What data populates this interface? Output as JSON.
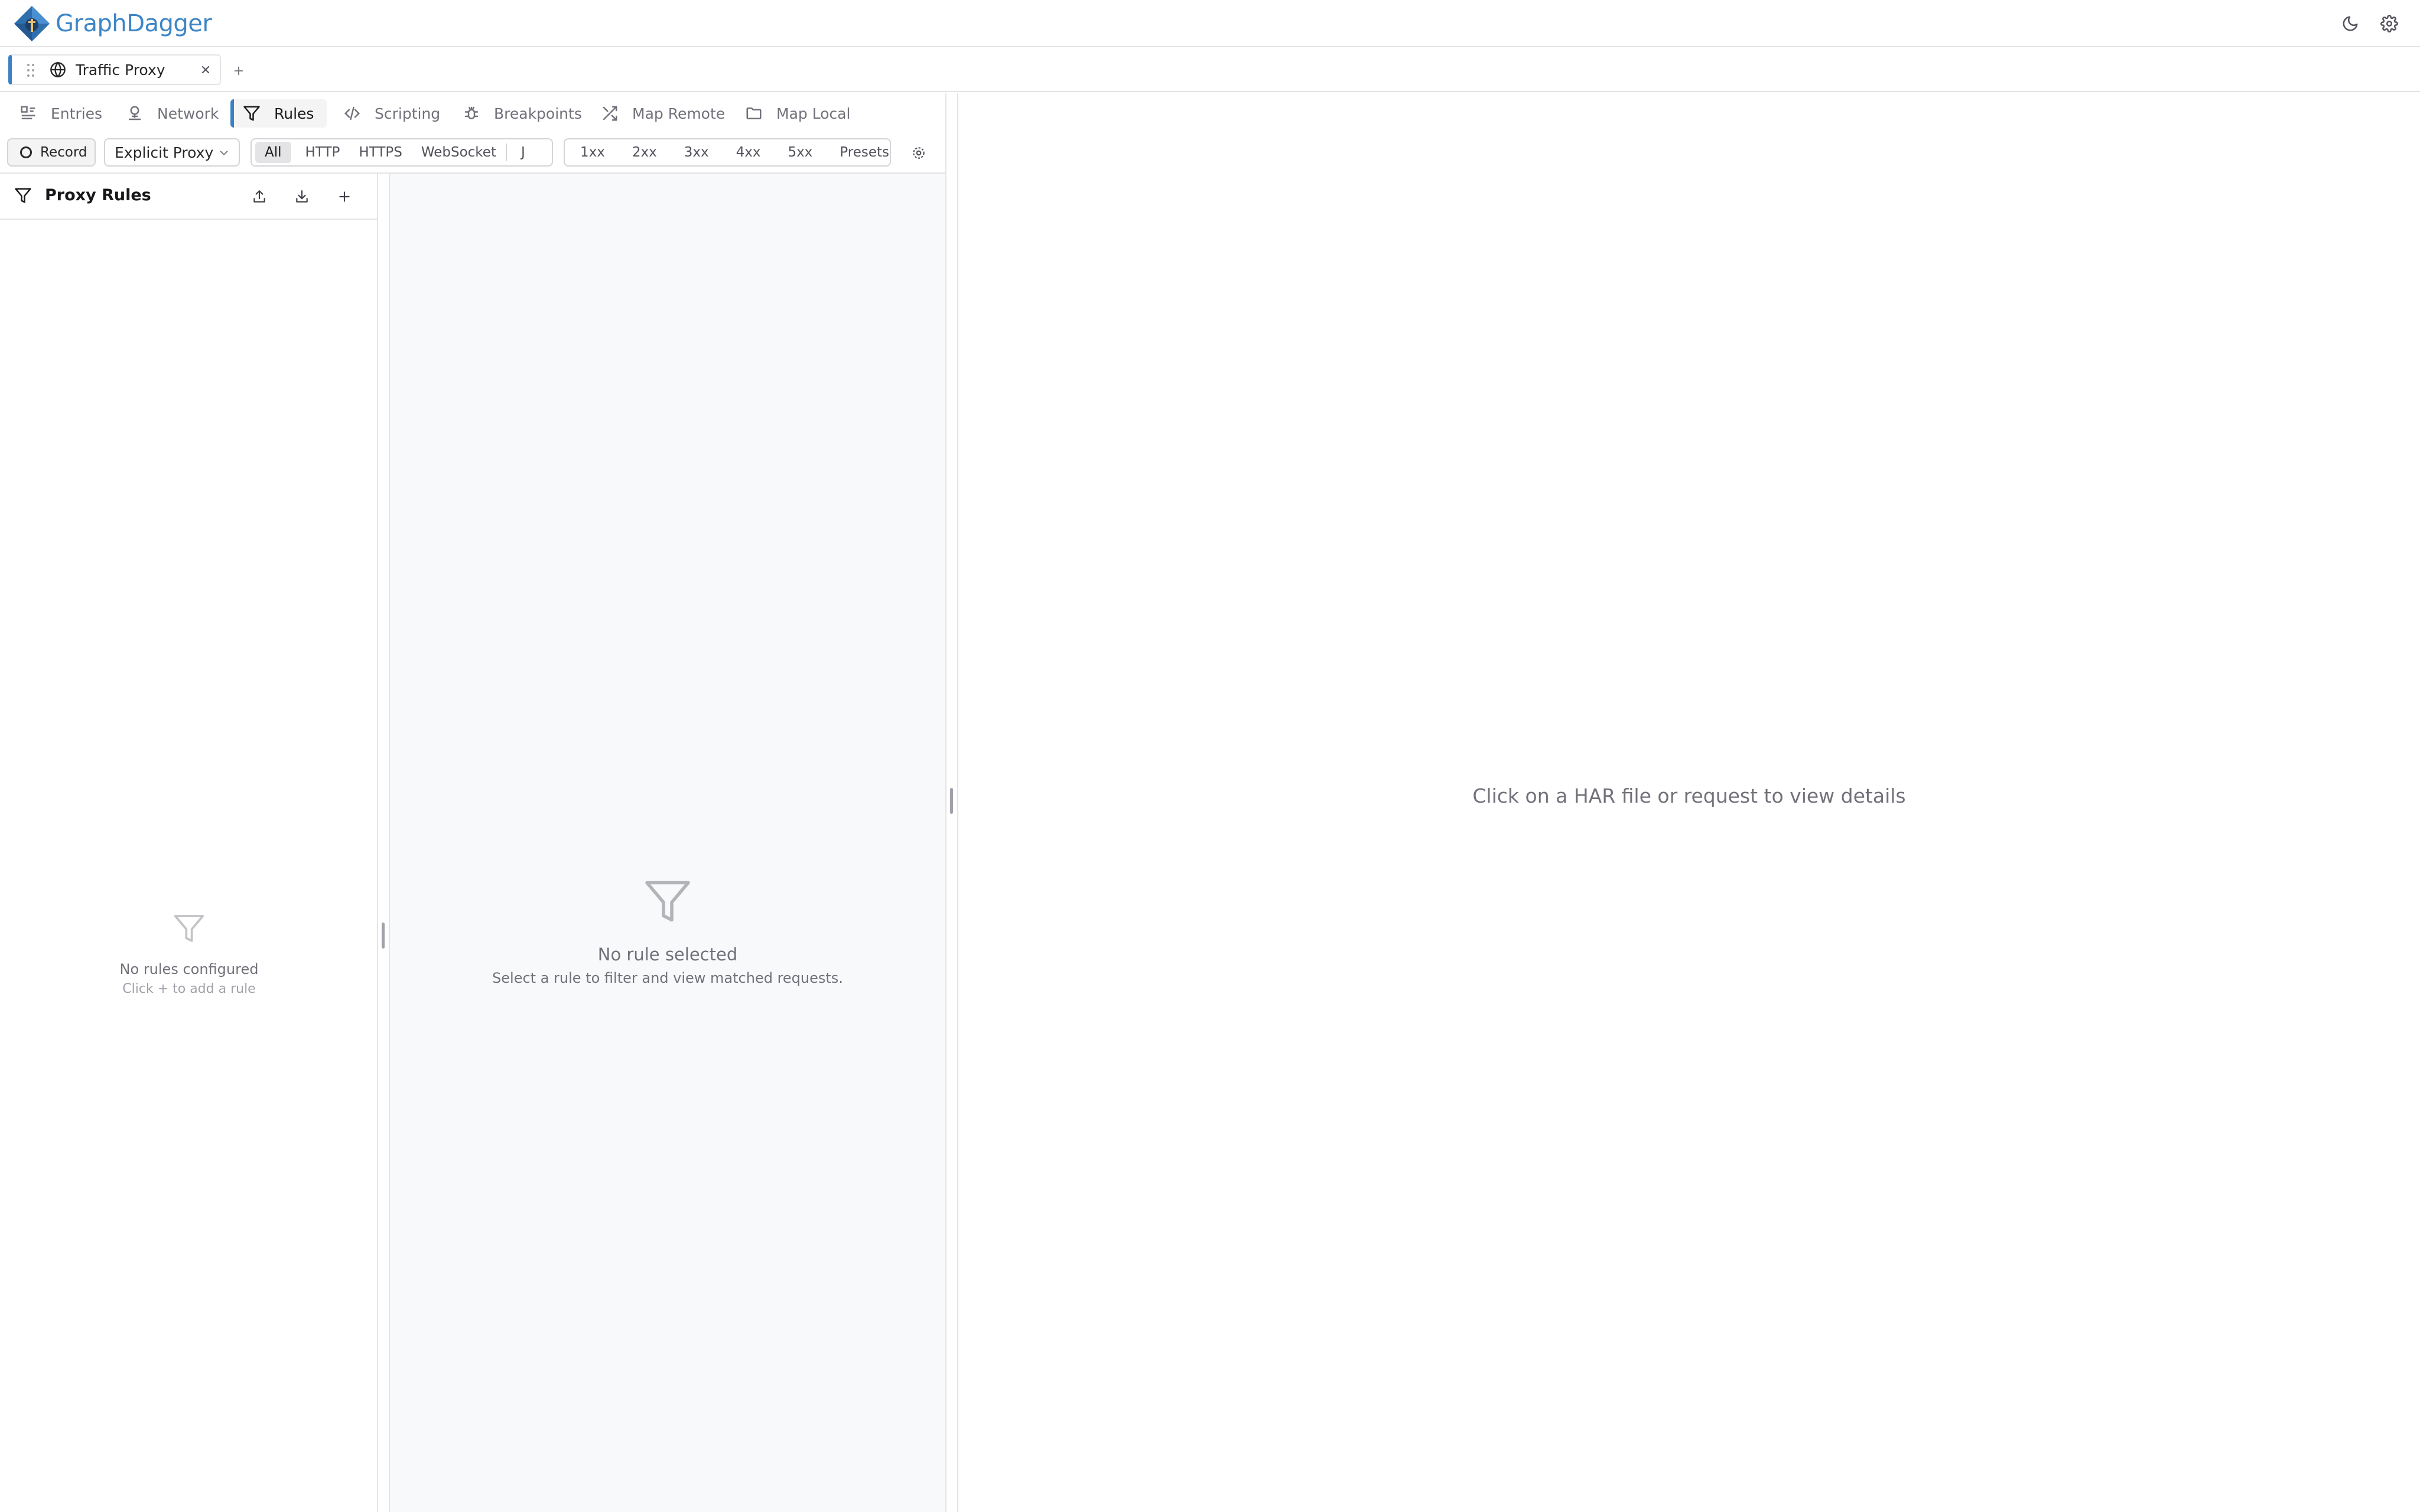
{
  "app": {
    "brand": "GraphDagger"
  },
  "colors": {
    "accent": "#3b82c4",
    "brand": "#3d86c6",
    "muted": "#71717a",
    "border": "#e4e4e7"
  },
  "header": {
    "icons": [
      "moon-icon",
      "gear-icon"
    ]
  },
  "workspace_tabs": [
    {
      "label": "Traffic Proxy",
      "icon": "globe-icon"
    }
  ],
  "nav_tabs": [
    {
      "label": "Entries",
      "icon": "list-icon"
    },
    {
      "label": "Network",
      "icon": "network-icon"
    },
    {
      "label": "Rules",
      "icon": "filter-icon",
      "active": true
    },
    {
      "label": "Scripting",
      "icon": "code-icon"
    },
    {
      "label": "Breakpoints",
      "icon": "bug-icon"
    },
    {
      "label": "Map Remote",
      "icon": "shuffle-icon"
    },
    {
      "label": "Map Local",
      "icon": "folder-icon"
    }
  ],
  "toolbar": {
    "record_label": "Record",
    "proxy_mode": "Explicit Proxy",
    "protocol_filters": [
      "All",
      "HTTP",
      "HTTPS",
      "WebSocket",
      "J"
    ],
    "protocol_selected": "All",
    "status_filters": [
      "1xx",
      "2xx",
      "3xx",
      "4xx",
      "5xx"
    ],
    "presets_label": "Presets"
  },
  "rules_panel": {
    "title": "Proxy Rules",
    "empty_title": "No rules configured",
    "empty_hint": "Click + to add a rule"
  },
  "match_panel": {
    "empty_title": "No rule selected",
    "empty_hint": "Select a rule to filter and view matched requests."
  },
  "detail_panel": {
    "empty_message": "Click on a HAR file or request to view details"
  }
}
